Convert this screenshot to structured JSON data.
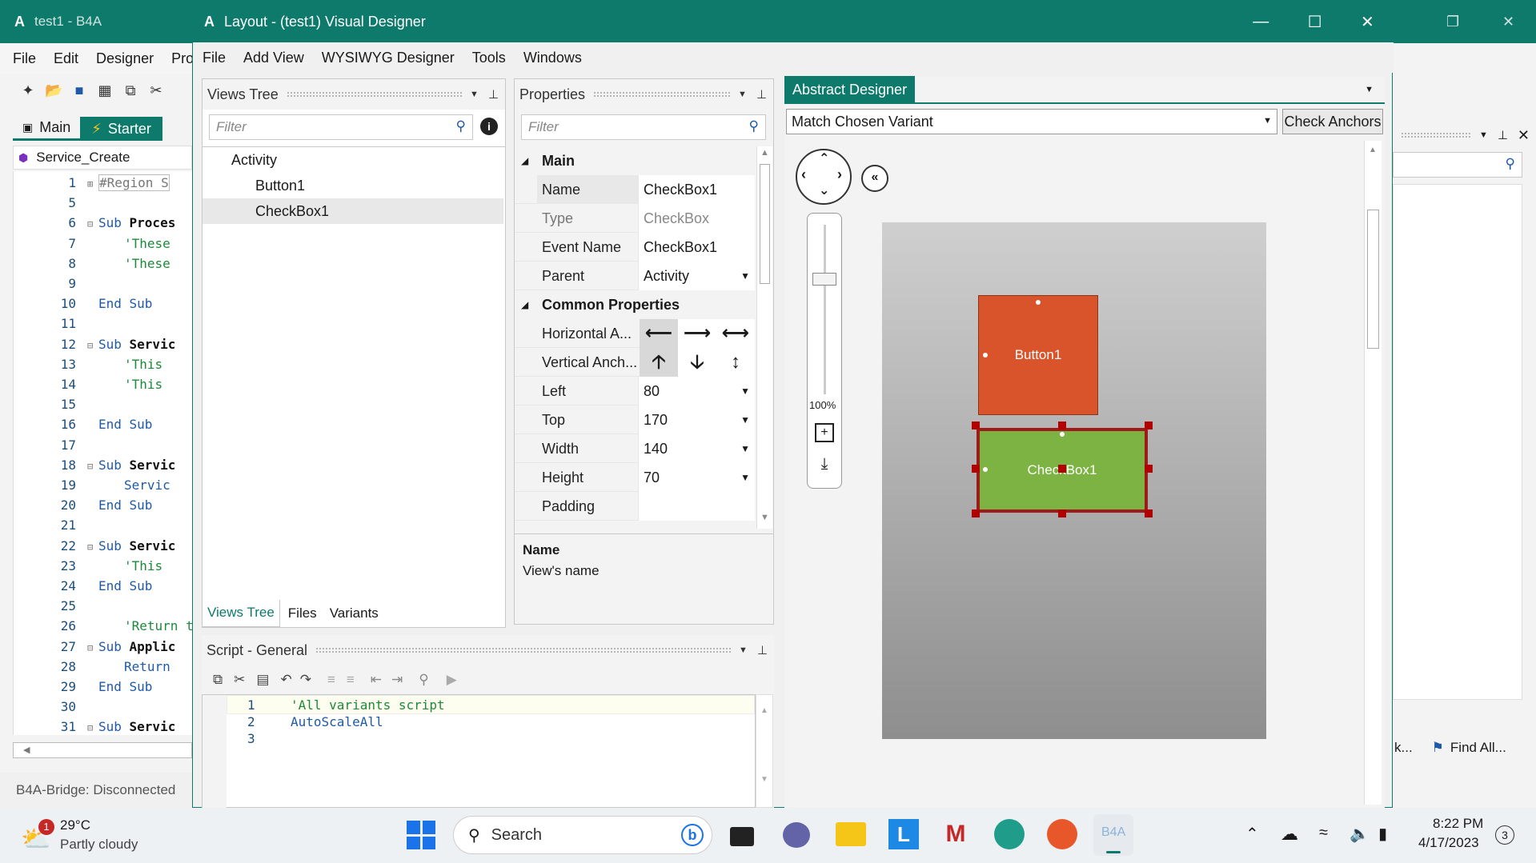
{
  "ide": {
    "title": "test1 - B4A",
    "menu": [
      "File",
      "Edit",
      "Designer",
      "Pro"
    ],
    "tabs": {
      "main": "Main",
      "starter": "Starter"
    },
    "sub_select": "Service_Create",
    "code_lines": [
      {
        "n": "1",
        "fold": "⊞",
        "text": "#Region  S",
        "cls": "region"
      },
      {
        "n": "5",
        "fold": "",
        "text": "",
        "cls": ""
      },
      {
        "n": "6",
        "fold": "⊟",
        "kw": "Sub",
        "text": "Proces",
        "cls": "sub"
      },
      {
        "n": "7",
        "fold": "",
        "text": "'These",
        "cls": "cm"
      },
      {
        "n": "8",
        "fold": "",
        "text": "'These",
        "cls": "cm"
      },
      {
        "n": "9",
        "fold": "",
        "text": "",
        "cls": ""
      },
      {
        "n": "10",
        "fold": "",
        "text": "End Sub",
        "cls": "endsub"
      },
      {
        "n": "11",
        "fold": "",
        "text": "",
        "cls": ""
      },
      {
        "n": "12",
        "fold": "⊟",
        "kw": "Sub",
        "text": "Servic",
        "cls": "sub"
      },
      {
        "n": "13",
        "fold": "",
        "text": "'This",
        "cls": "cm"
      },
      {
        "n": "14",
        "fold": "",
        "text": "'This",
        "cls": "cm"
      },
      {
        "n": "15",
        "fold": "",
        "text": "",
        "cls": ""
      },
      {
        "n": "16",
        "fold": "",
        "text": "End Sub",
        "cls": "endsub"
      },
      {
        "n": "17",
        "fold": "",
        "text": "",
        "cls": ""
      },
      {
        "n": "18",
        "fold": "⊟",
        "kw": "Sub",
        "text": "Servic",
        "cls": "sub"
      },
      {
        "n": "19",
        "fold": "",
        "text": "Servic",
        "cls": "kwi"
      },
      {
        "n": "20",
        "fold": "",
        "text": "End Sub",
        "cls": "endsub"
      },
      {
        "n": "21",
        "fold": "",
        "text": "",
        "cls": ""
      },
      {
        "n": "22",
        "fold": "⊟",
        "kw": "Sub",
        "text": "Servic",
        "cls": "sub"
      },
      {
        "n": "23",
        "fold": "",
        "text": "'This",
        "cls": "cm"
      },
      {
        "n": "24",
        "fold": "",
        "text": "End Sub",
        "cls": "endsub"
      },
      {
        "n": "25",
        "fold": "",
        "text": "",
        "cls": ""
      },
      {
        "n": "26",
        "fold": "",
        "text": "'Return tr",
        "cls": "cm"
      },
      {
        "n": "27",
        "fold": "⊟",
        "kw": "Sub",
        "text": "Applic",
        "cls": "sub"
      },
      {
        "n": "28",
        "fold": "",
        "text": "Return",
        "cls": "kwi"
      },
      {
        "n": "29",
        "fold": "",
        "text": "End Sub",
        "cls": "endsub"
      },
      {
        "n": "30",
        "fold": "",
        "text": "",
        "cls": ""
      },
      {
        "n": "31",
        "fold": "⊟",
        "kw": "Sub",
        "text": "Servic",
        "cls": "sub"
      }
    ],
    "status": "B4A-Bridge: Disconnected",
    "find_all": "Find All...",
    "truncated_left": "k..."
  },
  "designer": {
    "title": "Layout - (test1) Visual Designer",
    "menu": [
      "File",
      "Add View",
      "WYSIWYG Designer",
      "Tools",
      "Windows"
    ],
    "views_tree": {
      "header": "Views Tree",
      "filter_placeholder": "Filter",
      "items": [
        "Activity",
        "Button1",
        "CheckBox1"
      ],
      "tabs": [
        "Views Tree",
        "Files",
        "Variants"
      ]
    },
    "properties": {
      "header": "Properties",
      "filter_placeholder": "Filter",
      "section_main": "Main",
      "section_common": "Common Properties",
      "rows": [
        {
          "key": "Name",
          "value": "CheckBox1"
        },
        {
          "key": "Type",
          "value": "CheckBox"
        },
        {
          "key": "Event Name",
          "value": "CheckBox1"
        },
        {
          "key": "Parent",
          "value": "Activity"
        }
      ],
      "anchor_h": "Horizontal A...",
      "anchor_v": "Vertical Anch...",
      "rows2": [
        {
          "key": "Left",
          "value": "80"
        },
        {
          "key": "Top",
          "value": "170"
        },
        {
          "key": "Width",
          "value": "140"
        },
        {
          "key": "Height",
          "value": "70"
        },
        {
          "key": "Padding",
          "value": ""
        }
      ],
      "desc_title": "Name",
      "desc_text": "View's name"
    },
    "script": {
      "header": "Script - General",
      "lines": [
        {
          "n": "1",
          "text": "'All variants script"
        },
        {
          "n": "2",
          "text": "AutoScaleAll"
        },
        {
          "n": "3",
          "text": ""
        }
      ]
    },
    "abstract": {
      "tab": "Abstract Designer",
      "variant_select": "Match Chosen Variant",
      "check_anchors": "Check Anchors",
      "zoom": "100%",
      "button_label": "Button1",
      "checkbox_label": "CheckBox1"
    }
  },
  "taskbar": {
    "weather_temp": "29°C",
    "weather_desc": "Partly cloudy",
    "weather_badge": "1",
    "search": "Search",
    "time": "8:22 PM",
    "date": "4/17/2023",
    "notif_count": "3",
    "b4a_label": "B4A"
  },
  "colors": {
    "accent": "#0e7a6c",
    "button_fill": "#d9542b",
    "checkbox_fill": "#7cb342",
    "selection": "#9e1b1b"
  }
}
